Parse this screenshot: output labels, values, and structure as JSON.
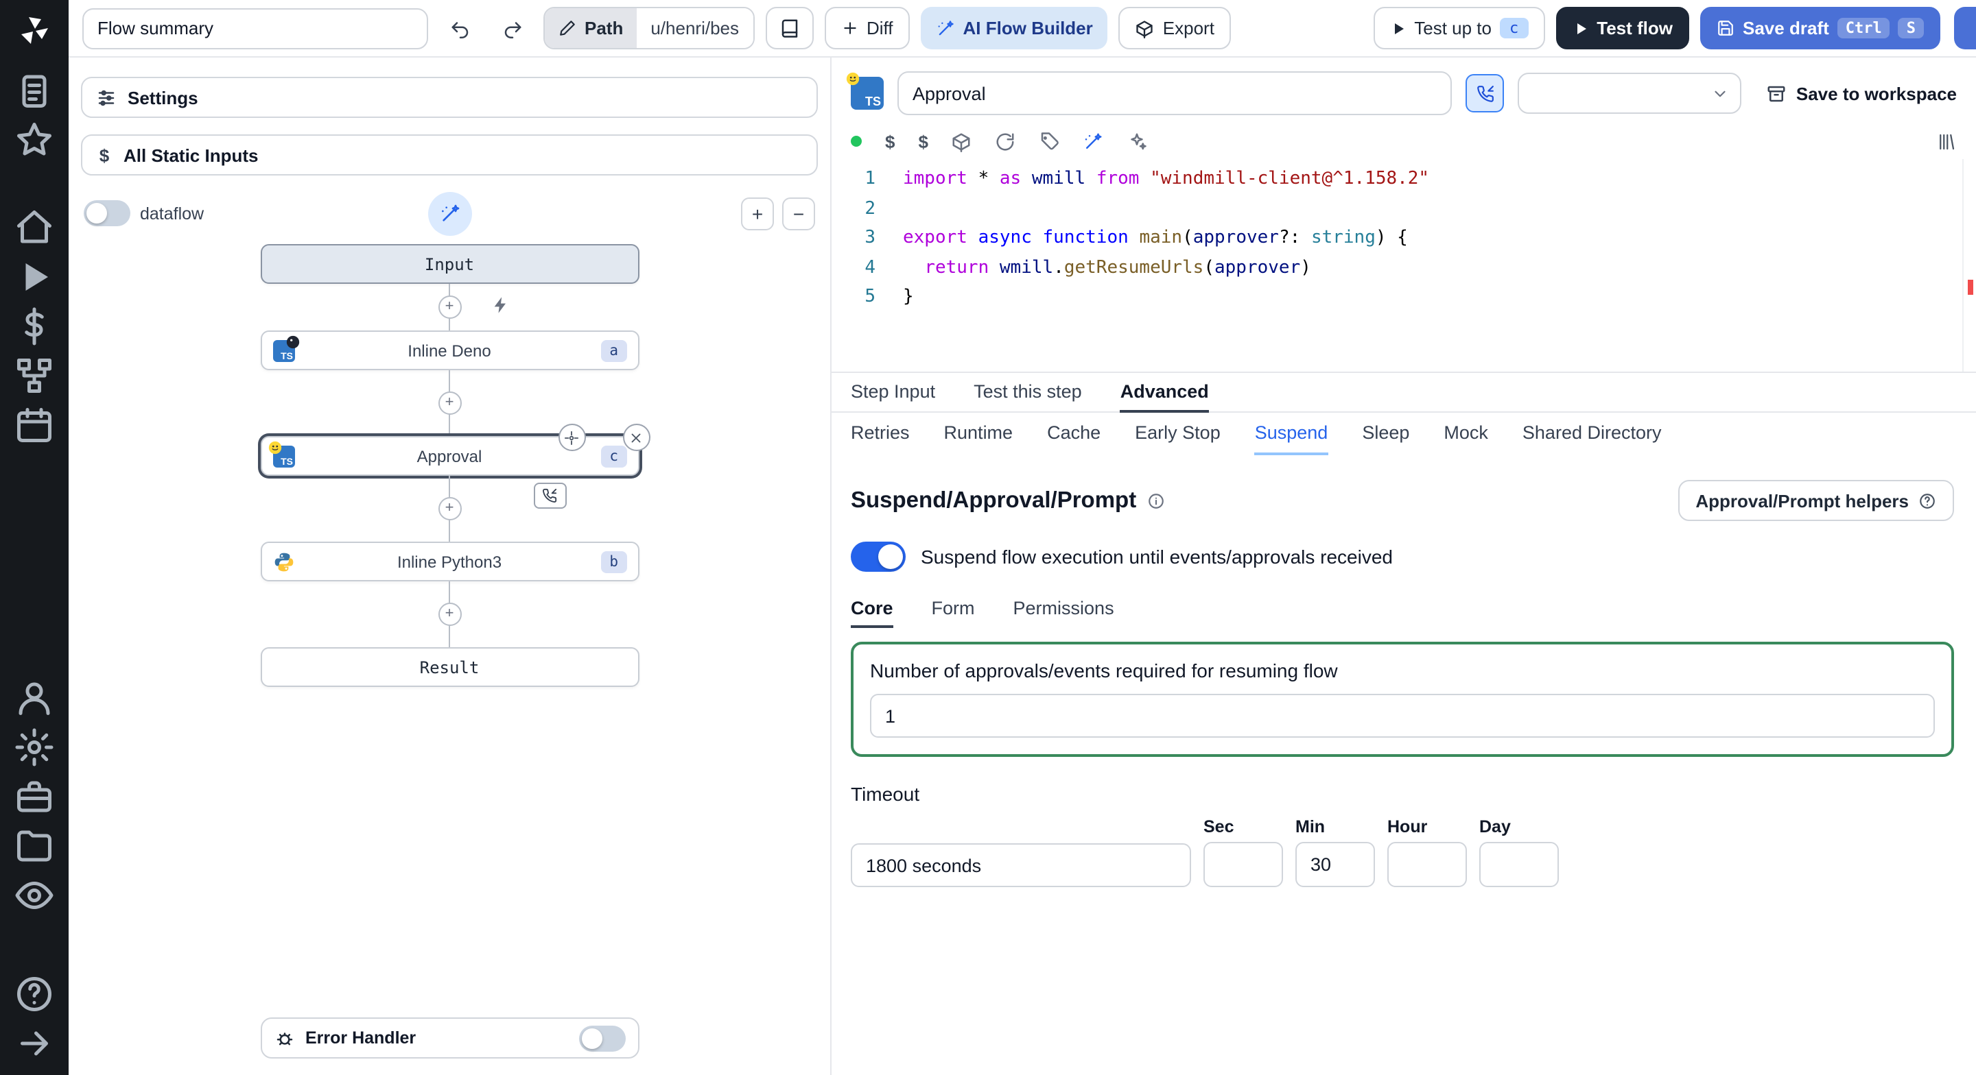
{
  "colors": {
    "accent_blue": "#2563eb",
    "save_button": "#4a70d6",
    "dark_button": "#1d2736",
    "suspend_green": "#3a8a5c",
    "success_green": "#22c55e",
    "rail_bg": "#16191d"
  },
  "rail": {
    "groups": [
      [
        "clipboard",
        "star"
      ],
      [
        "home",
        "play",
        "dollar",
        "flow",
        "calendar"
      ],
      [
        "user",
        "gear",
        "toolbox",
        "folder",
        "eye"
      ],
      [
        "help",
        "arrow-right"
      ]
    ]
  },
  "topbar": {
    "flow_summary": "Flow summary",
    "path_label": "Path",
    "path_value": "u/henri/bes",
    "diff": "Diff",
    "ai_flow_builder": "AI Flow Builder",
    "export": "Export",
    "test_up_to": "Test up to",
    "test_up_to_badge": "c",
    "test_flow": "Test flow",
    "save_draft": "Save draft",
    "save_draft_kbd": [
      "Ctrl",
      "S"
    ]
  },
  "flow_panel": {
    "settings": "Settings",
    "static_inputs": "All Static Inputs",
    "dataflow": "dataflow",
    "zoom_plus": "+",
    "zoom_minus": "−",
    "nodes": {
      "input": "Input",
      "deno_label": "Inline Deno",
      "deno_badge": "a",
      "approval_label": "Approval",
      "approval_badge": "c",
      "python_label": "Inline Python3",
      "python_badge": "b",
      "result": "Result"
    },
    "error_handler": "Error Handler"
  },
  "editor": {
    "step_name": "Approval",
    "save_to_workspace": "Save to workspace",
    "workspace_select_value": "",
    "line_numbers": [
      "1",
      "2",
      "3",
      "4",
      "5"
    ],
    "code_lines": [
      [
        [
          "import",
          "kw-purple"
        ],
        [
          " * ",
          "plain"
        ],
        [
          "as",
          "kw-purple"
        ],
        [
          " ",
          "plain"
        ],
        [
          "wmill",
          "var"
        ],
        [
          " ",
          "plain"
        ],
        [
          "from",
          "kw-purple"
        ],
        [
          " ",
          "plain"
        ],
        [
          "\"windmill-client@^1.158.2\"",
          "str"
        ]
      ],
      [],
      [
        [
          "export",
          "kw-purple"
        ],
        [
          " ",
          "plain"
        ],
        [
          "async",
          "kw-blue"
        ],
        [
          " ",
          "plain"
        ],
        [
          "function",
          "kw-blue"
        ],
        [
          " ",
          "plain"
        ],
        [
          "main",
          "fn"
        ],
        [
          "(",
          "plain"
        ],
        [
          "approver",
          "var"
        ],
        [
          "?: ",
          "plain"
        ],
        [
          "string",
          "type"
        ],
        [
          ") {",
          "plain"
        ]
      ],
      [
        [
          "  ",
          "plain"
        ],
        [
          "return",
          "kw-purple"
        ],
        [
          " ",
          "plain"
        ],
        [
          "wmill",
          "var"
        ],
        [
          ".",
          "plain"
        ],
        [
          "getResumeUrls",
          "fn"
        ],
        [
          "(",
          "plain"
        ],
        [
          "approver",
          "var"
        ],
        [
          ")",
          "plain"
        ]
      ],
      [
        [
          "}",
          "plain"
        ]
      ]
    ]
  },
  "tabs": {
    "step_tabs": [
      "Step Input",
      "Test this step",
      "Advanced"
    ],
    "step_tabs_active": 2,
    "advanced_tabs": [
      "Retries",
      "Runtime",
      "Cache",
      "Early Stop",
      "Suspend",
      "Sleep",
      "Mock",
      "Shared Directory"
    ],
    "advanced_tabs_active": 4
  },
  "suspend": {
    "title": "Suspend/Approval/Prompt",
    "helpers_button": "Approval/Prompt helpers",
    "toggle_label": "Suspend flow execution until events/approvals received",
    "subtabs": [
      "Core",
      "Form",
      "Permissions"
    ],
    "subtabs_active": 0,
    "approvals_label": "Number of approvals/events required for resuming flow",
    "approvals_value": "1",
    "timeout_label": "Timeout",
    "timeout_value": "1800 seconds",
    "timeout_cols": [
      {
        "label": "Sec",
        "value": ""
      },
      {
        "label": "Min",
        "value": "30"
      },
      {
        "label": "Hour",
        "value": ""
      },
      {
        "label": "Day",
        "value": ""
      }
    ]
  }
}
